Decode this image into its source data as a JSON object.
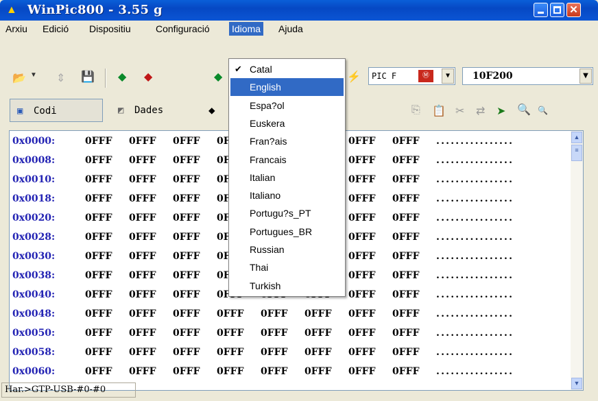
{
  "window": {
    "title": "WinPic800   - 3.55 g"
  },
  "menu": {
    "items": [
      "Arxiu",
      "Edició",
      "Dispositiu",
      "Configuració",
      "Idioma",
      "Ajuda"
    ],
    "active": "Idioma"
  },
  "toolbar": {
    "device_family": "PIC F",
    "device": "10F200"
  },
  "tabs": {
    "code": "Codi",
    "data": "Dades"
  },
  "grid": {
    "addresses": [
      "0x0000:",
      "0x0008:",
      "0x0010:",
      "0x0018:",
      "0x0020:",
      "0x0028:",
      "0x0030:",
      "0x0038:",
      "0x0040:",
      "0x0048:",
      "0x0050:",
      "0x0058:",
      "0x0060:"
    ],
    "word": "0FFF",
    "ascii": "................"
  },
  "language_menu": {
    "items": [
      "Catal",
      "English",
      "Espa?ol",
      "Euskera",
      "Fran?ais",
      "Francais",
      "Italian",
      "Italiano",
      "Portugu?s_PT",
      "Portugues_BR",
      "Russian",
      "Thai",
      "Turkish"
    ],
    "checked": "Catal",
    "highlighted": "English"
  },
  "status": {
    "hardware": "Har.>GTP-USB-#0-#0"
  },
  "colors": {
    "title_bar": "#0648c4",
    "highlight": "#316ac5",
    "address": "#2424b4"
  }
}
